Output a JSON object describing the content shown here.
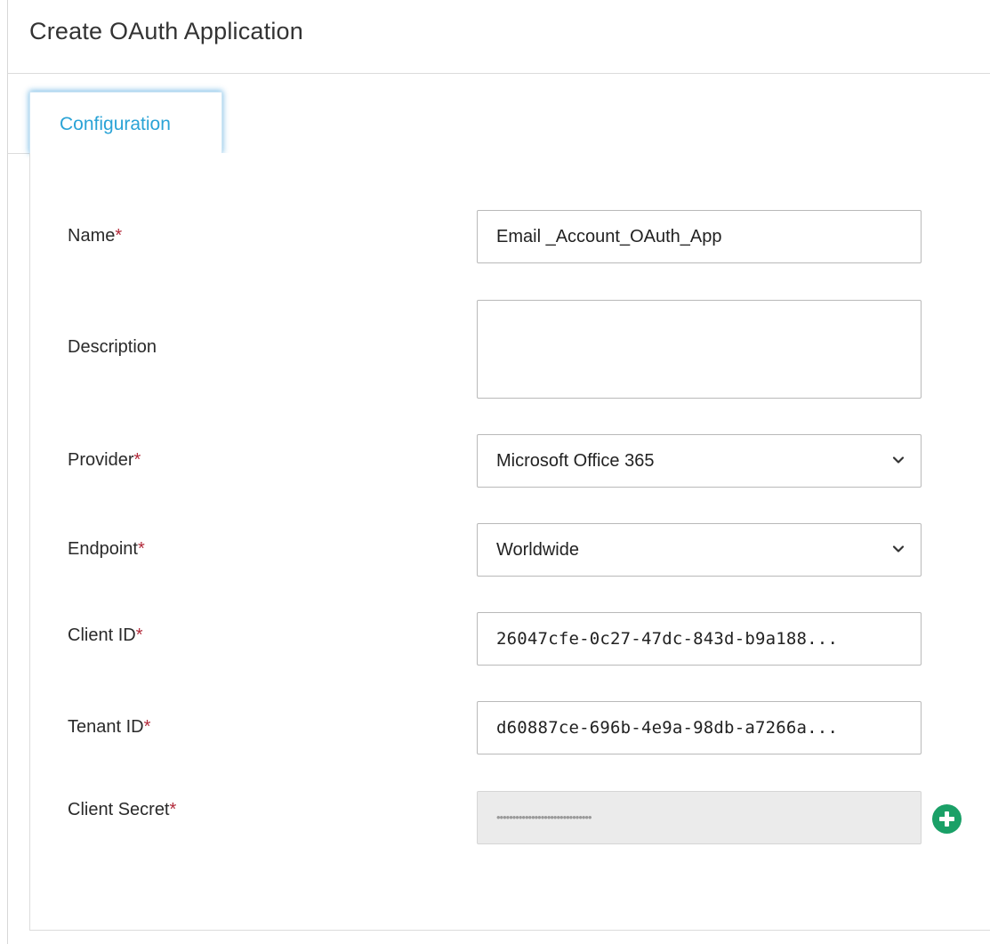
{
  "window": {
    "title": "Create OAuth Application"
  },
  "tabs": [
    {
      "label": "Configuration",
      "active": true
    }
  ],
  "form": {
    "name": {
      "label": "Name",
      "required_mark": "*",
      "value": "Email _Account_OAuth_App"
    },
    "description": {
      "label": "Description",
      "value": ""
    },
    "provider": {
      "label": "Provider",
      "required_mark": "*",
      "value": "Microsoft Office 365",
      "icon": "chevron-down-icon"
    },
    "endpoint": {
      "label": "Endpoint",
      "required_mark": "*",
      "value": "Worldwide",
      "icon": "chevron-down-icon"
    },
    "client_id": {
      "label": "Client ID",
      "required_mark": "*",
      "value": "26047cfe-0c27-47dc-843d-b9a188..."
    },
    "tenant_id": {
      "label": "Tenant ID",
      "required_mark": "*",
      "value": "d60887ce-696b-4e9a-98db-a7266a..."
    },
    "client_secret": {
      "label": "Client Secret",
      "required_mark": "*",
      "value": "••••••••••••••••••••••••••••••",
      "add_icon": "plus-circle-icon"
    }
  },
  "colors": {
    "accent_tab": "#2aa3d6",
    "required_mark": "#b22a3a",
    "add_button": "#1aa067",
    "disabled_bg": "#ebebeb"
  }
}
